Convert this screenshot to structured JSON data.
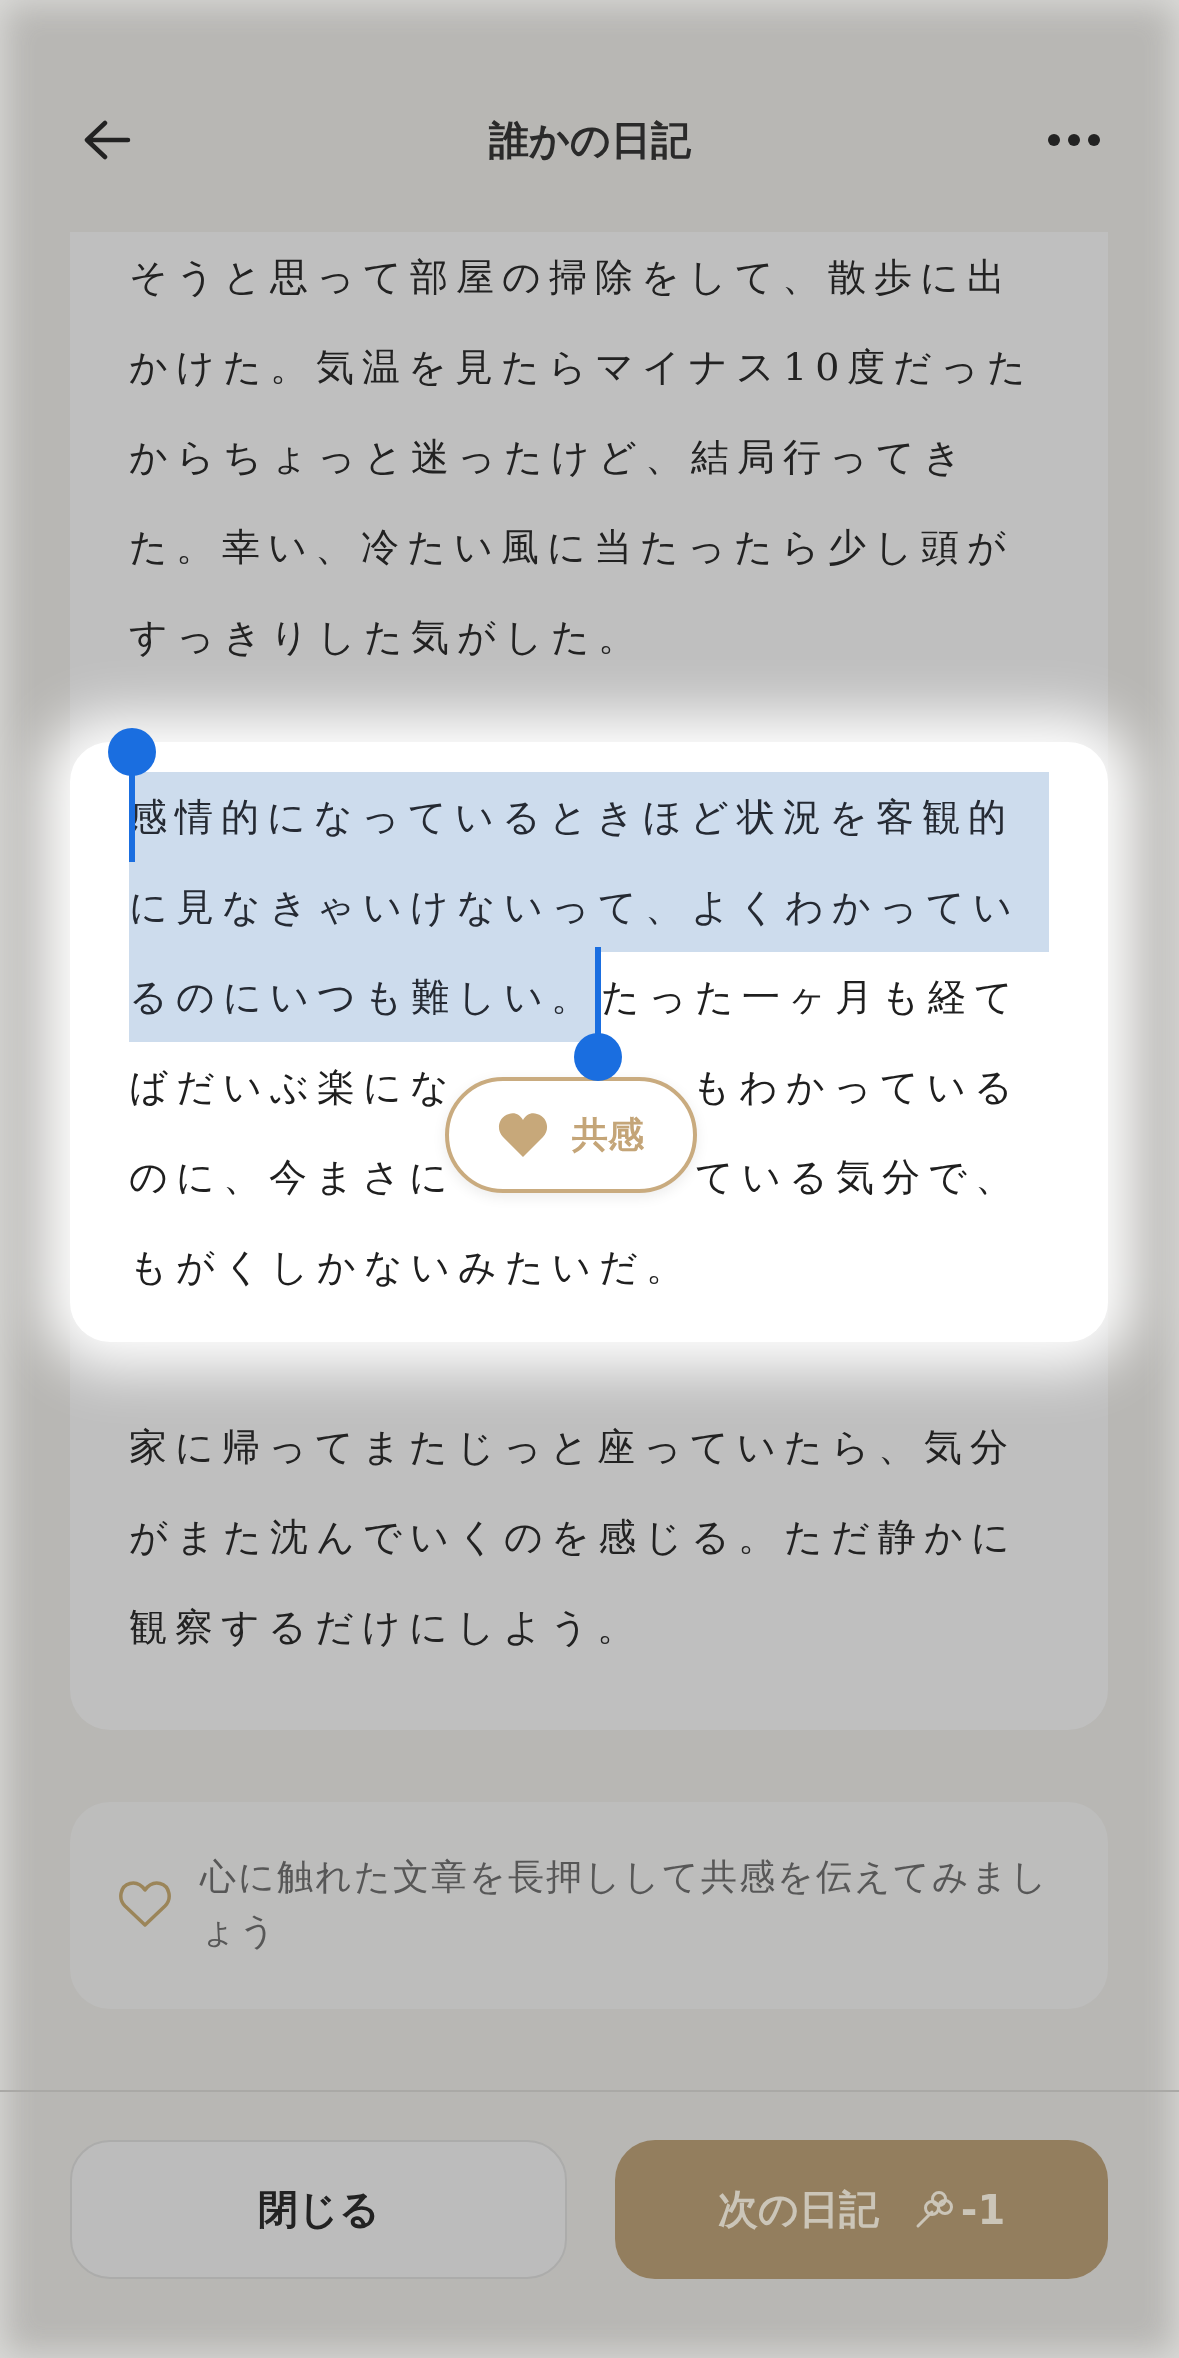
{
  "header": {
    "title": "誰かの日記"
  },
  "diary": {
    "paragraphs": [
      {
        "kind": "text",
        "lines": [
          "そうと思って部屋の掃除をして、散歩に出",
          "かけた。気温を見たらマイナス10度だった",
          "からちょっと迷ったけど、結局行ってき",
          "た。幸い、冷たい風に当たったら少し頭が",
          "すっきりした気がした。"
        ]
      },
      {
        "kind": "selection",
        "lines": [
          {
            "segments": [
              {
                "text": "感情的になっているときほど状況を客観的",
                "selected": true
              }
            ]
          },
          {
            "segments": [
              {
                "text": "に見なきゃいけないって、よくわかってい",
                "selected": true
              }
            ]
          },
          {
            "segments": [
              {
                "text": "るのにいつも難しい。",
                "selected": true
              },
              {
                "text": "たった一ヶ月も経て",
                "selected": false
              }
            ]
          },
          {
            "segments": [
              {
                "text": "ばだいぶ楽にな",
                "selected": false
              },
              {
                "text": "もわかっている",
                "selected": false
              }
            ]
          },
          {
            "segments": [
              {
                "text": "のに、今まさに",
                "selected": false
              },
              {
                "text": "ている気分で、",
                "selected": false
              }
            ]
          },
          {
            "segments": [
              {
                "text": "もがくしかないみたいだ。",
                "selected": false
              }
            ]
          }
        ]
      },
      {
        "kind": "text",
        "lines": [
          "家に帰ってまたじっと座っていたら、気分",
          "がまた沈んでいくのを感じる。ただ静かに",
          "観察するだけにしよう。"
        ]
      }
    ]
  },
  "popover": {
    "label": "共感"
  },
  "hint": {
    "text": "心に触れた文章を長押しして共感を伝えてみましょう"
  },
  "footer": {
    "buttons": [
      {
        "kind": "secondary",
        "label": "閉じる"
      },
      {
        "kind": "primary",
        "label": "次の日記",
        "cost": "-1"
      }
    ]
  }
}
